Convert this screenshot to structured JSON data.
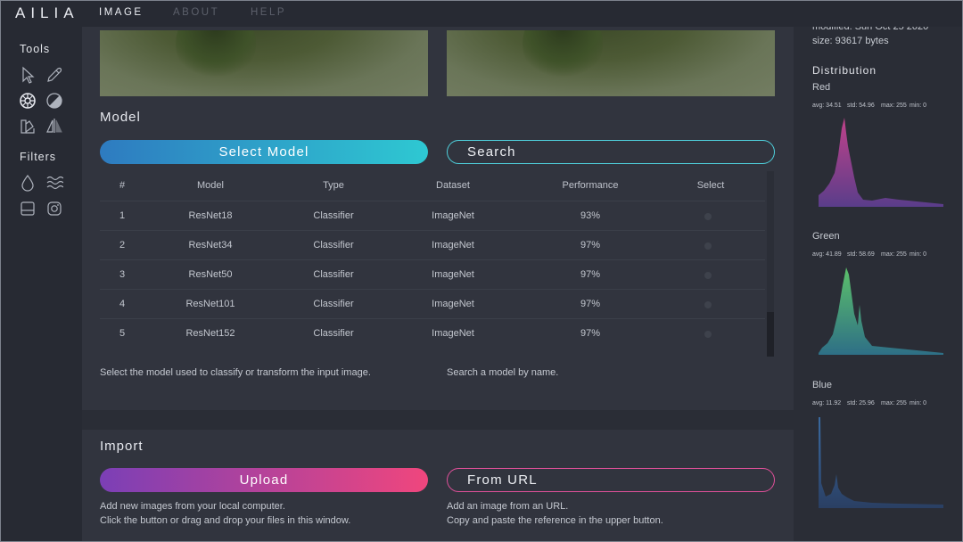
{
  "app": {
    "logo": "AILIA"
  },
  "nav": {
    "items": [
      {
        "label": "IMAGE",
        "active": true
      },
      {
        "label": "ABOUT",
        "active": false
      },
      {
        "label": "HELP",
        "active": false
      }
    ]
  },
  "sidebar": {
    "tools_title": "Tools",
    "tools": [
      "cursor-icon",
      "eyedropper-icon",
      "color-wheel-icon",
      "contrast-icon",
      "palette-icon",
      "symmetry-icon"
    ],
    "filters_title": "Filters",
    "filters": [
      "drop-icon",
      "waves-icon",
      "tilt-shift-icon",
      "instagram-icon"
    ]
  },
  "model": {
    "title": "Model",
    "select_label": "Select Model",
    "search_label": "Search",
    "table": {
      "headers": [
        "#",
        "Model",
        "Type",
        "Dataset",
        "Performance",
        "Select"
      ],
      "rows": [
        {
          "num": "1",
          "model": "ResNet18",
          "type": "Classifier",
          "dataset": "ImageNet",
          "performance": "93%"
        },
        {
          "num": "2",
          "model": "ResNet34",
          "type": "Classifier",
          "dataset": "ImageNet",
          "performance": "97%"
        },
        {
          "num": "3",
          "model": "ResNet50",
          "type": "Classifier",
          "dataset": "ImageNet",
          "performance": "97%"
        },
        {
          "num": "4",
          "model": "ResNet101",
          "type": "Classifier",
          "dataset": "ImageNet",
          "performance": "97%"
        },
        {
          "num": "5",
          "model": "ResNet152",
          "type": "Classifier",
          "dataset": "ImageNet",
          "performance": "97%"
        }
      ]
    },
    "select_desc": "Select the model used to classify or transform the input image.",
    "search_desc": "Search a model by name."
  },
  "import": {
    "title": "Import",
    "upload_label": "Upload",
    "url_label": "From URL",
    "upload_desc_1": "Add new images from your local computer.",
    "upload_desc_2": "Click the button or drag and drop your files in this window.",
    "url_desc_1": "Add an image from an URL.",
    "url_desc_2": "Copy and paste the reference in the upper button."
  },
  "info": {
    "modified": "modified: Sun Oct 25 2020",
    "size": "size: 93617 bytes",
    "distribution_title": "Distribution",
    "channels": [
      {
        "name": "Red",
        "avg": "avg: 34.51",
        "std": "std: 54.96",
        "max": "max: 255",
        "min": "min: 0",
        "colors": [
          "#5a3d8a",
          "#c0428a"
        ]
      },
      {
        "name": "Green",
        "avg": "avg: 41.89",
        "std": "std: 58.69",
        "max": "max: 255",
        "min": "min: 0",
        "colors": [
          "#2e6f86",
          "#5cc06a"
        ]
      },
      {
        "name": "Blue",
        "avg": "avg: 11.92",
        "std": "std: 25.96",
        "max": "max: 255",
        "min": "min: 0",
        "colors": [
          "#2f4d78",
          "#3a6aa0"
        ]
      }
    ]
  },
  "colors": {
    "select_gradient": [
      "#2e7bc0",
      "#2ec8d2"
    ],
    "search_outline": "#4fd0dc",
    "upload_gradient": [
      "#7b3fb6",
      "#f0467d"
    ],
    "url_outline": "#e0509a"
  }
}
